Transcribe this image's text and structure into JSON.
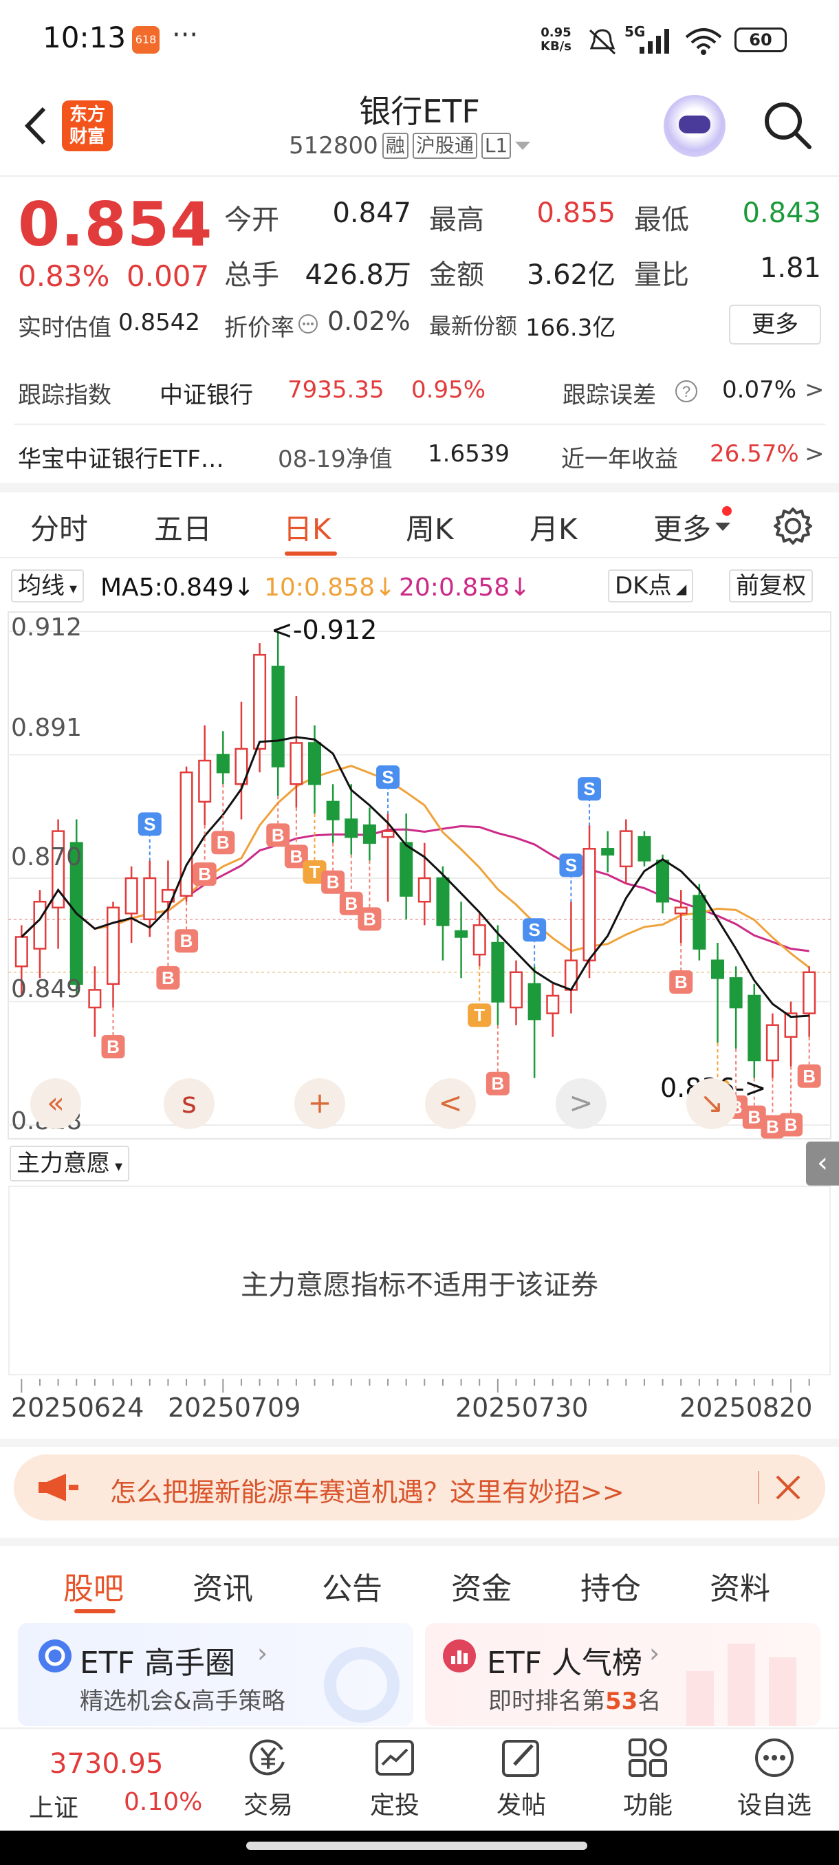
{
  "status_bar": {
    "time": "10:13",
    "app_badge": "618",
    "more": "···",
    "speed_top": "0.95",
    "speed_bottom": "KB/s",
    "network": "5G",
    "battery": "60"
  },
  "header": {
    "title": "银行ETF",
    "code": "512800",
    "tags": [
      "融",
      "沪股通",
      "L1"
    ],
    "logo_top": "东方",
    "logo_bottom": "财富"
  },
  "quote": {
    "price": "0.854",
    "change_pct": "0.83%",
    "change": "0.007",
    "open_label": "今开",
    "open": "0.847",
    "high_label": "最高",
    "high": "0.855",
    "low_label": "最低",
    "low": "0.843",
    "volume_label": "总手",
    "volume": "426.8万",
    "amount_label": "金额",
    "amount": "3.62亿",
    "ratio_label": "量比",
    "ratio": "1.81",
    "iopv_label": "实时估值",
    "iopv": "0.8542",
    "discount_label": "折价率",
    "discount": "0.02%",
    "shares_label": "最新份额",
    "shares": "166.3亿",
    "more_label": "更多"
  },
  "tracking": {
    "index_label": "跟踪指数",
    "index_name": "中证银行",
    "index_value": "7935.35",
    "index_pct": "0.95%",
    "error_label": "跟踪误差",
    "error_value": "0.07%",
    "fund_name": "华宝中证银行ETF…",
    "nav_label": "08-19净值",
    "nav_value": "1.6539",
    "yield_label": "近一年收益",
    "yield_value": "26.57%"
  },
  "kline_tabs": [
    "分时",
    "五日",
    "日K",
    "周K",
    "月K",
    "更多"
  ],
  "ma_bar": {
    "type": "均线",
    "ma5": "MA5:0.849↓",
    "ma10": "10:0.858↓",
    "ma20": "20:0.858↓",
    "dk": "DK点",
    "adjust": "前复权"
  },
  "chart_data": {
    "type": "candlestick",
    "ylim": [
      0.828,
      0.912
    ],
    "y_ticks": [
      "0.912",
      "0.891",
      "0.870",
      "0.849",
      "0.828"
    ],
    "max_label": "<-0.912",
    "min_label": "0.836->",
    "x_ticks": [
      "20250624",
      "20250709",
      "20250730",
      "20250820"
    ],
    "candles": [
      {
        "o": 0.855,
        "h": 0.862,
        "l": 0.85,
        "c": 0.86
      },
      {
        "o": 0.858,
        "h": 0.868,
        "l": 0.853,
        "c": 0.866
      },
      {
        "o": 0.865,
        "h": 0.88,
        "l": 0.858,
        "c": 0.878
      },
      {
        "o": 0.876,
        "h": 0.88,
        "l": 0.85,
        "c": 0.852
      },
      {
        "o": 0.848,
        "h": 0.855,
        "l": 0.843,
        "c": 0.851
      },
      {
        "o": 0.852,
        "h": 0.866,
        "l": 0.848,
        "c": 0.865
      },
      {
        "o": 0.864,
        "h": 0.872,
        "l": 0.859,
        "c": 0.87
      },
      {
        "o": 0.863,
        "h": 0.873,
        "l": 0.86,
        "c": 0.87
      },
      {
        "o": 0.866,
        "h": 0.873,
        "l": 0.863,
        "c": 0.868
      },
      {
        "o": 0.867,
        "h": 0.889,
        "l": 0.866,
        "c": 0.888
      },
      {
        "o": 0.883,
        "h": 0.896,
        "l": 0.879,
        "c": 0.89
      },
      {
        "o": 0.891,
        "h": 0.895,
        "l": 0.886,
        "c": 0.888
      },
      {
        "o": 0.886,
        "h": 0.9,
        "l": 0.88,
        "c": 0.892
      },
      {
        "o": 0.892,
        "h": 0.91,
        "l": 0.888,
        "c": 0.908
      },
      {
        "o": 0.906,
        "h": 0.912,
        "l": 0.884,
        "c": 0.889
      },
      {
        "o": 0.886,
        "h": 0.901,
        "l": 0.882,
        "c": 0.893
      },
      {
        "o": 0.893,
        "h": 0.896,
        "l": 0.881,
        "c": 0.886
      },
      {
        "o": 0.883,
        "h": 0.886,
        "l": 0.876,
        "c": 0.88
      },
      {
        "o": 0.88,
        "h": 0.886,
        "l": 0.874,
        "c": 0.877
      },
      {
        "o": 0.879,
        "h": 0.882,
        "l": 0.873,
        "c": 0.876
      },
      {
        "o": 0.877,
        "h": 0.881,
        "l": 0.866,
        "c": 0.878
      },
      {
        "o": 0.876,
        "h": 0.881,
        "l": 0.863,
        "c": 0.867
      },
      {
        "o": 0.866,
        "h": 0.876,
        "l": 0.862,
        "c": 0.87
      },
      {
        "o": 0.87,
        "h": 0.872,
        "l": 0.856,
        "c": 0.862
      },
      {
        "o": 0.861,
        "h": 0.866,
        "l": 0.853,
        "c": 0.86
      },
      {
        "o": 0.857,
        "h": 0.864,
        "l": 0.855,
        "c": 0.862
      },
      {
        "o": 0.859,
        "h": 0.862,
        "l": 0.845,
        "c": 0.849
      },
      {
        "o": 0.848,
        "h": 0.856,
        "l": 0.845,
        "c": 0.854
      },
      {
        "o": 0.852,
        "h": 0.855,
        "l": 0.836,
        "c": 0.846
      },
      {
        "o": 0.847,
        "h": 0.852,
        "l": 0.843,
        "c": 0.85
      },
      {
        "o": 0.851,
        "h": 0.866,
        "l": 0.847,
        "c": 0.856
      },
      {
        "o": 0.856,
        "h": 0.879,
        "l": 0.853,
        "c": 0.875
      },
      {
        "o": 0.875,
        "h": 0.878,
        "l": 0.871,
        "c": 0.874
      },
      {
        "o": 0.872,
        "h": 0.88,
        "l": 0.869,
        "c": 0.878
      },
      {
        "o": 0.877,
        "h": 0.878,
        "l": 0.872,
        "c": 0.873
      },
      {
        "o": 0.873,
        "h": 0.874,
        "l": 0.864,
        "c": 0.866
      },
      {
        "o": 0.864,
        "h": 0.868,
        "l": 0.859,
        "c": 0.865
      },
      {
        "o": 0.867,
        "h": 0.869,
        "l": 0.856,
        "c": 0.858
      },
      {
        "o": 0.856,
        "h": 0.859,
        "l": 0.842,
        "c": 0.853
      },
      {
        "o": 0.853,
        "h": 0.855,
        "l": 0.841,
        "c": 0.848
      },
      {
        "o": 0.85,
        "h": 0.852,
        "l": 0.836,
        "c": 0.839
      },
      {
        "o": 0.839,
        "h": 0.847,
        "l": 0.836,
        "c": 0.845
      },
      {
        "o": 0.843,
        "h": 0.849,
        "l": 0.838,
        "c": 0.847
      },
      {
        "o": 0.847,
        "h": 0.855,
        "l": 0.843,
        "c": 0.854
      }
    ],
    "signals": [
      {
        "i": 5,
        "t": "B"
      },
      {
        "i": 7,
        "t": "S"
      },
      {
        "i": 8,
        "t": "B"
      },
      {
        "i": 9,
        "t": "B"
      },
      {
        "i": 10,
        "t": "B"
      },
      {
        "i": 11,
        "t": "B"
      },
      {
        "i": 14,
        "t": "B"
      },
      {
        "i": 15,
        "t": "B"
      },
      {
        "i": 16,
        "t": "T"
      },
      {
        "i": 17,
        "t": "B"
      },
      {
        "i": 18,
        "t": "B"
      },
      {
        "i": 19,
        "t": "B"
      },
      {
        "i": 20,
        "t": "S"
      },
      {
        "i": 25,
        "t": "T"
      },
      {
        "i": 26,
        "t": "B"
      },
      {
        "i": 28,
        "t": "S"
      },
      {
        "i": 30,
        "t": "S"
      },
      {
        "i": 31,
        "t": "S"
      },
      {
        "i": 36,
        "t": "B"
      },
      {
        "i": 38,
        "t": "T"
      },
      {
        "i": 39,
        "t": "B"
      },
      {
        "i": 40,
        "t": "B"
      },
      {
        "i": 41,
        "t": "B"
      },
      {
        "i": 42,
        "t": "B"
      },
      {
        "i": 43,
        "t": "B"
      }
    ],
    "nav_buttons": [
      "«",
      "s",
      "+",
      "<",
      ">",
      "↘"
    ]
  },
  "panel2": {
    "selector": "主力意愿",
    "message": "主力意愿指标不适用于该证券"
  },
  "ad": {
    "text": "怎么把握新能源车赛道机遇？这里有妙招>>"
  },
  "bottom_tabs": [
    "股吧",
    "资讯",
    "公告",
    "资金",
    "持仓",
    "资料"
  ],
  "cards": [
    {
      "title": "ETF 高手圈",
      "subtitle": "精选机会&高手策略"
    },
    {
      "title": "ETF 人气榜",
      "subtitle_prefix": "即时排名第",
      "rank": "53",
      "subtitle_suffix": "名"
    }
  ],
  "bottom_nav": {
    "index_value": "3730.95",
    "index_name": "上证",
    "index_pct": "0.10%",
    "items": [
      "交易",
      "定投",
      "发帖",
      "功能",
      "设自选"
    ]
  },
  "colors": {
    "up": "#e23b3b",
    "down": "#1d9a3b",
    "accent": "#e8542a",
    "ma5": "#111111",
    "ma10": "#f0a23a",
    "ma20": "#cc2a88"
  }
}
